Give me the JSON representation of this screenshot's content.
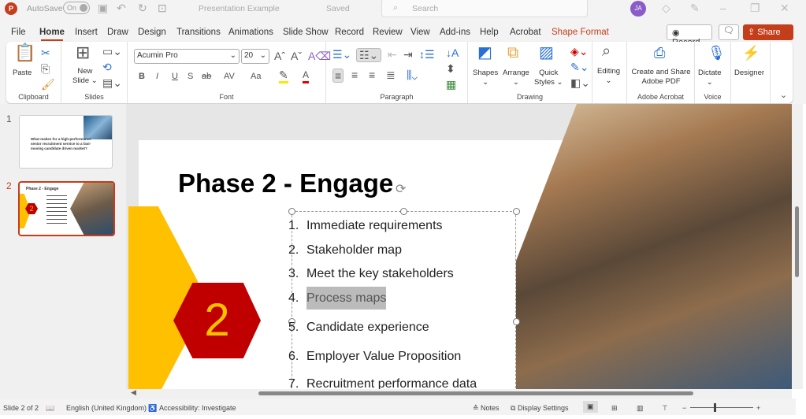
{
  "titlebar": {
    "autosave_label": "AutoSave",
    "autosave_state": "On",
    "document_title": "Presentation Example",
    "save_status": "Saved",
    "search_placeholder": "Search",
    "avatar_initials": "JA"
  },
  "tabs": [
    "File",
    "Home",
    "Insert",
    "Draw",
    "Design",
    "Transitions",
    "Animations",
    "Slide Show",
    "Record",
    "Review",
    "View",
    "Add-ins",
    "Help",
    "Acrobat",
    "Shape Format"
  ],
  "active_tab": "Home",
  "actions": {
    "record": "Record",
    "share": "Share"
  },
  "ribbon": {
    "clipboard": {
      "label": "Clipboard",
      "paste": "Paste"
    },
    "slides": {
      "label": "Slides",
      "new_slide_line1": "New",
      "new_slide_line2": "Slide"
    },
    "font": {
      "label": "Font",
      "font_name": "Acumin Pro",
      "font_size": "20",
      "bold": "B",
      "italic": "I",
      "underline": "U",
      "shadow": "S",
      "strike": "ab",
      "spacing": "AV",
      "case": "Aa"
    },
    "paragraph": {
      "label": "Paragraph"
    },
    "drawing": {
      "label": "Drawing",
      "shapes": "Shapes",
      "arrange": "Arrange",
      "quick_styles_1": "Quick",
      "quick_styles_2": "Styles"
    },
    "editing": {
      "label": "Editing"
    },
    "acrobat": {
      "label": "Adobe Acrobat",
      "btn1": "Create and Share",
      "btn2": "Adobe PDF"
    },
    "voice": {
      "label": "Voice",
      "dictate": "Dictate"
    },
    "designer": {
      "label": "Designer"
    }
  },
  "thumbnails": [
    {
      "number": "1",
      "text": "What makes for a high-performance senior recruitment service to a fast-moving candidate driven market?"
    },
    {
      "number": "2",
      "title": "Phase 2 - Engage",
      "badge": "2"
    }
  ],
  "slide": {
    "title": "Phase 2 - Engage",
    "badge": "2",
    "items": [
      {
        "num": "1.",
        "text": "Immediate requirements"
      },
      {
        "num": "2.",
        "text": "Stakeholder map"
      },
      {
        "num": "3.",
        "text": "Meet the key stakeholders"
      },
      {
        "num": "4.",
        "text": "Process maps"
      },
      {
        "num": "5.",
        "text": "Candidate experience"
      },
      {
        "num": "6.",
        "text": "Employer Value Proposition"
      },
      {
        "num": "7.",
        "text": "Recruitment performance data"
      }
    ]
  },
  "status": {
    "slide": "Slide 2 of 2",
    "language": "English (United Kingdom)",
    "accessibility": "Accessibility: Investigate",
    "notes": "Notes",
    "display": "Display Settings"
  },
  "colors": {
    "accent": "#c43e1c",
    "yellow": "#ffc000",
    "red": "#c00000"
  }
}
